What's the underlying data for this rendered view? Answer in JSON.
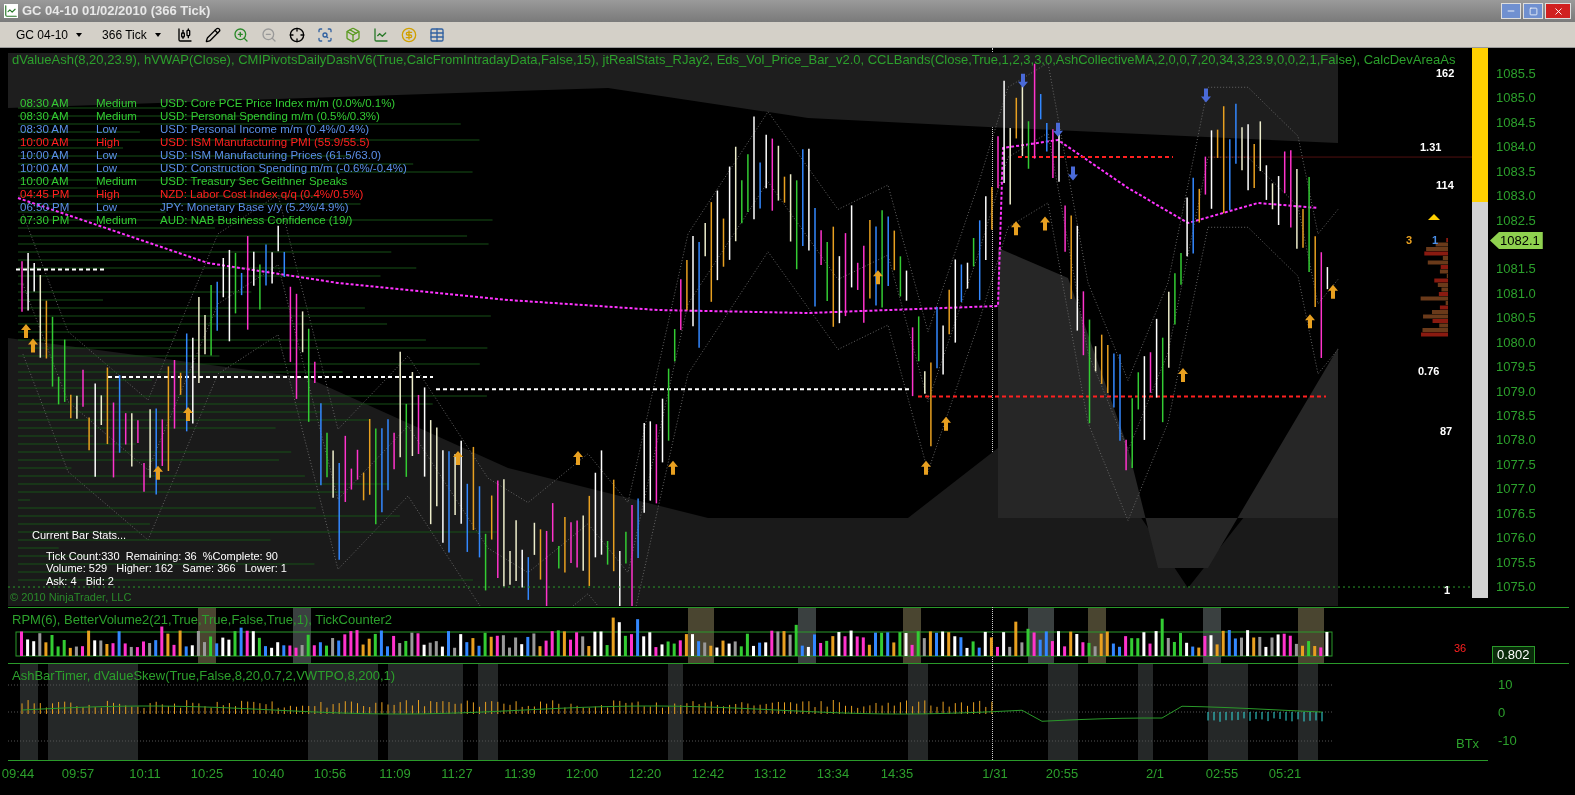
{
  "window": {
    "title": "GC 04-10  01/02/2010 (366 Tick)"
  },
  "toolbar": {
    "instrument": "GC 04-10",
    "period": "366 Tick"
  },
  "price_panel": {
    "indicators": "dValueAsh(8,20,23.9), hVWAP(Close), CMIPivotsDailyDashV6(True,CalcFromIntradayData,False,15), jtRealStats_RJay2, Eds_Vol_Price_Bar_v2.0, CCLBands(Close,True,1,2,3,3,0,AshCollectiveMA,2,0,0,7,20,34,3,23.9,0,0,2,1,False), CalcDevAreaAs",
    "news": [
      {
        "time": "08:30 AM",
        "impact": "Medium",
        "event": "USD: Core PCE Price Index m/m (0.0%/0.1%)",
        "color": "#33cc33"
      },
      {
        "time": "08:30 AM",
        "impact": "Medium",
        "event": "USD: Personal Spending m/m (0.5%/0.3%)",
        "color": "#33cc33"
      },
      {
        "time": "08:30 AM",
        "impact": "Low",
        "event": "USD: Personal Income m/m (0.4%/0.4%)",
        "color": "#5b8fe8"
      },
      {
        "time": "10:00 AM",
        "impact": "High",
        "event": "USD: ISM Manufacturing PMI (55.9/55.5)",
        "color": "#ff2020"
      },
      {
        "time": "10:00 AM",
        "impact": "Low",
        "event": "USD: ISM Manufacturing Prices (61.5/63.0)",
        "color": "#5b8fe8"
      },
      {
        "time": "10:00 AM",
        "impact": "Low",
        "event": "USD: Construction Spending m/m (-0.6%/-0.4%)",
        "color": "#5b8fe8"
      },
      {
        "time": "10:00 AM",
        "impact": "Medium",
        "event": "USD: Treasury Sec Geithner Speaks",
        "color": "#33cc33"
      },
      {
        "time": "04:45 PM",
        "impact": "High",
        "event": "NZD: Labor Cost Index q/q (0.4%/0.5%)",
        "color": "#ff2020"
      },
      {
        "time": "06:50 PM",
        "impact": "Low",
        "event": "JPY: Monetary Base y/y (5.2%/4.9%)",
        "color": "#5b8fe8"
      },
      {
        "time": "07:30 PM",
        "impact": "Medium",
        "event": "AUD: NAB Business Confidence (19/)",
        "color": "#33cc33"
      }
    ],
    "stats": {
      "title": "Current Bar Stats...",
      "lines": [
        "Tick Count:330  Remaining: 36  %Complete: 90",
        "Volume: 529   Higher: 162   Same: 366   Lower: 1",
        "Ask: 4   Bid: 2"
      ]
    },
    "copyright": "© 2010 NinjaTrader, LLC",
    "labels": [
      {
        "text": "162",
        "color": "#ffffff"
      },
      {
        "text": "1.31",
        "color": "#ffffff"
      },
      {
        "text": "114",
        "color": "#ffffff"
      },
      {
        "text": "3",
        "color": "#e8a020"
      },
      {
        "text": "1",
        "color": "#4a8fe8"
      },
      {
        "text": "0.76",
        "color": "#ffffff"
      },
      {
        "text": "87",
        "color": "#ffffff"
      },
      {
        "text": "1",
        "color": "#ffffff"
      }
    ],
    "meter": {
      "level": 0.28
    },
    "price_axis": [
      "1085.5",
      "1085.0",
      "1084.5",
      "1084.0",
      "1083.5",
      "1083.0",
      "1082.5",
      "1081.5",
      "1081.0",
      "1080.5",
      "1080.0",
      "1079.5",
      "1079.0",
      "1078.5",
      "1078.0",
      "1077.5",
      "1077.0",
      "1076.5",
      "1076.0",
      "1075.5",
      "1075.0"
    ],
    "last_price": "1082.1"
  },
  "volume_panel": {
    "indicators": "RPM(6), BetterVolume2(21,True,True,False,True,1), TickCounter2",
    "counter": "36",
    "last_value": "0.802"
  },
  "skew_panel": {
    "indicators": "AshBarTimer, dValueSkew(True,False,8,20,0.7,2,VWTPO,8,200,1)",
    "axis": [
      "10",
      "0",
      "-10"
    ],
    "label": "BTx"
  },
  "time_axis": [
    "09:44",
    "09:57",
    "10:11",
    "10:25",
    "10:40",
    "10:56",
    "11:09",
    "11:27",
    "11:39",
    "12:00",
    "12:20",
    "12:42",
    "13:12",
    "13:34",
    "14:35",
    "1/31",
    "20:55",
    "2/1",
    "02:55",
    "05:21"
  ]
}
